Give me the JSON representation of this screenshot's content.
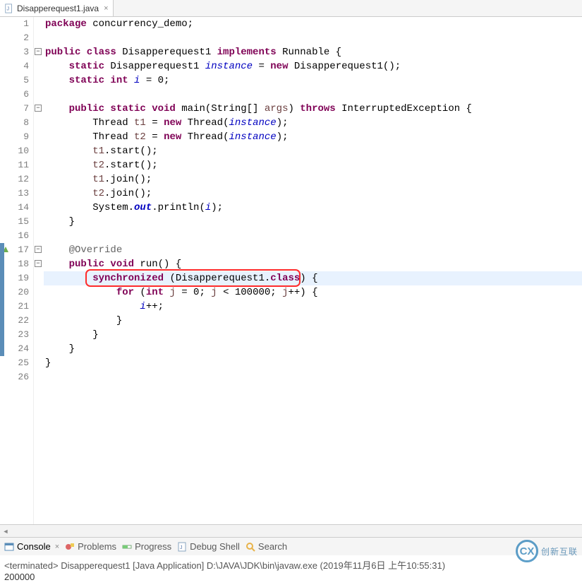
{
  "tab": {
    "filename": "Disapperequest1.java",
    "close": "×"
  },
  "lines": {
    "l1": [
      "package ",
      "concurrency_demo;"
    ],
    "l3a": "public class ",
    "l3b": "Disapperequest1 ",
    "l3c": "implements ",
    "l3d": "Runnable {",
    "l4a": "    static ",
    "l4b": "Disapperequest1 ",
    "l4c": "instance",
    "l4d": " = ",
    "l4e": "new ",
    "l4f": "Disapperequest1();",
    "l5a": "    static int ",
    "l5b": "i",
    "l5c": " = 0;",
    "l7a": "    public static void ",
    "l7b": "main(String[] ",
    "l7c": "args",
    "l7d": ") ",
    "l7e": "throws ",
    "l7f": "InterruptedException {",
    "l8a": "        Thread ",
    "l8b": "t1",
    "l8c": " = ",
    "l8d": "new ",
    "l8e": "Thread(",
    "l8f": "instance",
    "l8g": ");",
    "l9a": "        Thread ",
    "l9b": "t2",
    "l9c": " = ",
    "l9d": "new ",
    "l9e": "Thread(",
    "l9f": "instance",
    "l9g": ");",
    "l10a": "        t1",
    "l10b": ".start();",
    "l11a": "        t2",
    "l11b": ".start();",
    "l12a": "        t1",
    "l12b": ".join();",
    "l13a": "        t2",
    "l13b": ".join();",
    "l14a": "        System.",
    "l14b": "out",
    "l14c": ".println(",
    "l14d": "i",
    "l14e": ");",
    "l15": "    }",
    "l17": "    @Override",
    "l18a": "    public void ",
    "l18b": "run() {",
    "l19a": "        synchronized ",
    "l19b": "(Disapperequest1.",
    "l19c": "class",
    "l19d": ") ",
    "l19e": "{",
    "l20a": "            for ",
    "l20b": "(",
    "l20c": "int ",
    "l20d": "j",
    "l20e": " = 0; ",
    "l20f": "j",
    "l20g": " < 100000; ",
    "l20h": "j",
    "l20i": "++) {",
    "l21a": "                ",
    "l21b": "i",
    "l21c": "++;",
    "l22": "            }",
    "l23": "        }",
    "l24": "    }",
    "l25": "}"
  },
  "lineNumbers": [
    "1",
    "2",
    "3",
    "4",
    "5",
    "6",
    "7",
    "8",
    "9",
    "10",
    "11",
    "12",
    "13",
    "14",
    "15",
    "16",
    "17",
    "18",
    "19",
    "20",
    "21",
    "22",
    "23",
    "24",
    "25",
    "26"
  ],
  "consoleTabs": {
    "console": "Console",
    "problems": "Problems",
    "progress": "Progress",
    "debugShell": "Debug Shell",
    "search": "Search"
  },
  "console": {
    "terminated": "<terminated> Disapperequest1 [Java Application] D:\\JAVA\\JDK\\bin\\javaw.exe (2019年11月6日 上午10:55:31)",
    "output": "200000"
  },
  "watermark": {
    "logo": "CX",
    "text": "创新互联"
  }
}
